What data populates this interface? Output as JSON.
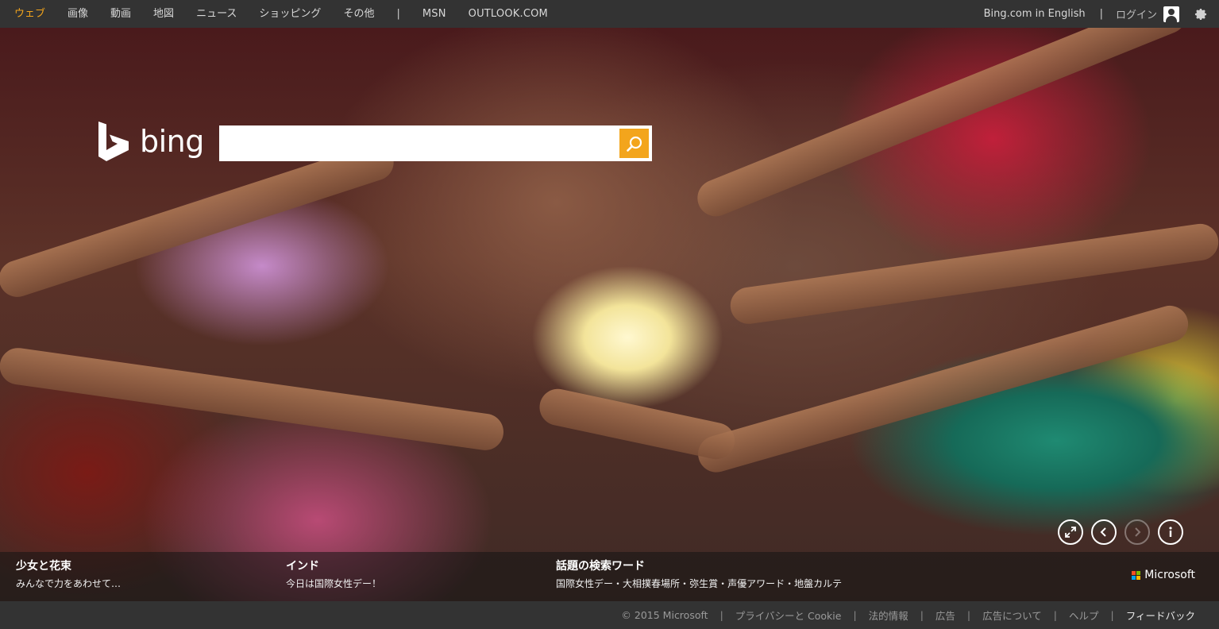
{
  "nav": {
    "items": [
      {
        "label": "ウェブ",
        "active": true
      },
      {
        "label": "画像"
      },
      {
        "label": "動画"
      },
      {
        "label": "地図"
      },
      {
        "label": "ニュース"
      },
      {
        "label": "ショッピング"
      },
      {
        "label": "その他"
      }
    ],
    "separator": "|",
    "msn": "MSN",
    "outlook": "OUTLOOK.COM"
  },
  "topright": {
    "english_link": "Bing.com in English",
    "separator": "|",
    "login": "ログイン"
  },
  "logo": {
    "text": "bing"
  },
  "search": {
    "value": "",
    "placeholder": ""
  },
  "info": {
    "image_title": "少女と花束",
    "image_caption": "みんなで力をあわせて…",
    "country_title": "インド",
    "country_caption": "今日は国際女性デー！",
    "trending_title": "話題の検索ワード",
    "trending_terms": [
      "国際女性デー",
      "大相撲春場所",
      "弥生賞",
      "声優アワード",
      "地盤カルテ"
    ],
    "trending_separator": "・"
  },
  "brand": {
    "microsoft": "Microsoft"
  },
  "footer": {
    "copyright": "© 2015 Microsoft",
    "privacy": "プライバシーと Cookie",
    "legal": "法的情報",
    "ads": "広告",
    "about_ads": "広告について",
    "help": "ヘルプ",
    "feedback": "フィードバック",
    "separator": "|"
  },
  "colors": {
    "accent": "#f3a51c",
    "topbar": "#333333",
    "footer": "#333333"
  },
  "icons": [
    "bing-logo-icon",
    "search-icon",
    "user-icon",
    "gear-icon",
    "fullscreen-icon",
    "previous-icon",
    "next-icon",
    "info-icon",
    "microsoft-logo-icon"
  ]
}
